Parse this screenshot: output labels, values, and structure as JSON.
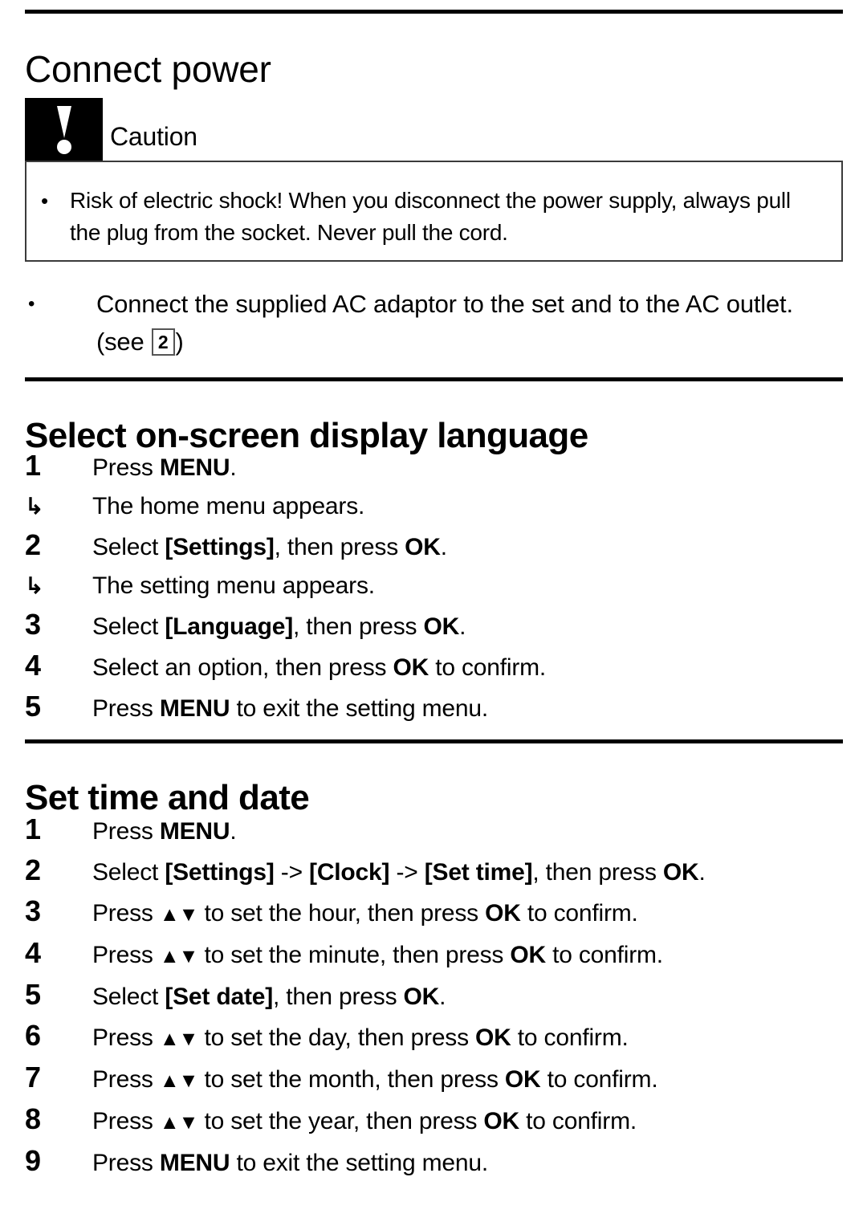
{
  "document": {
    "sections": [
      {
        "id": "connect-power",
        "title": "Connect power",
        "caution": {
          "label": "Caution",
          "bullet_marker": "•",
          "text": "Risk of electric shock! When you disconnect the power supply, always pull the plug from the socket. Never pull the cord."
        },
        "bullet": {
          "marker": "•",
          "text_before": "Connect the supplied AC adaptor to the set and to the AC outlet.  (see ",
          "figure_ref": "2",
          "text_after": ")"
        }
      },
      {
        "id": "select-language",
        "title": "Select on-screen display language",
        "steps": [
          {
            "number": "1",
            "parts": [
              {
                "text": "Press ",
                "bold": false
              },
              {
                "text": "MENU",
                "bold": true
              },
              {
                "text": ".",
                "bold": false
              }
            ],
            "result": {
              "arrow": "↳",
              "text": "The home menu appears."
            }
          },
          {
            "number": "2",
            "parts": [
              {
                "text": "Select ",
                "bold": false
              },
              {
                "text": "[Settings]",
                "bold": true
              },
              {
                "text": ", then press ",
                "bold": false
              },
              {
                "text": "OK",
                "bold": true
              },
              {
                "text": ".",
                "bold": false
              }
            ],
            "result": {
              "arrow": "↳",
              "text": "The setting menu appears."
            }
          },
          {
            "number": "3",
            "parts": [
              {
                "text": "Select ",
                "bold": false
              },
              {
                "text": "[Language]",
                "bold": true
              },
              {
                "text": ", then press ",
                "bold": false
              },
              {
                "text": "OK",
                "bold": true
              },
              {
                "text": ".",
                "bold": false
              }
            ]
          },
          {
            "number": "4",
            "parts": [
              {
                "text": "Select an option, then press ",
                "bold": false
              },
              {
                "text": "OK",
                "bold": true
              },
              {
                "text": " to confirm.",
                "bold": false
              }
            ]
          },
          {
            "number": "5",
            "parts": [
              {
                "text": "Press ",
                "bold": false
              },
              {
                "text": "MENU",
                "bold": true
              },
              {
                "text": " to exit the setting menu.",
                "bold": false
              }
            ]
          }
        ]
      },
      {
        "id": "set-time-date",
        "title": "Set time and date",
        "steps": [
          {
            "number": "1",
            "parts": [
              {
                "text": "Press ",
                "bold": false
              },
              {
                "text": "MENU",
                "bold": true
              },
              {
                "text": ".",
                "bold": false
              }
            ]
          },
          {
            "number": "2",
            "parts": [
              {
                "text": "Select ",
                "bold": false
              },
              {
                "text": "[Settings]",
                "bold": true
              },
              {
                "text": " -> ",
                "bold": false
              },
              {
                "text": "[Clock]",
                "bold": true
              },
              {
                "text": " -> ",
                "bold": false
              },
              {
                "text": "[Set time]",
                "bold": true
              },
              {
                "text": ", then press ",
                "bold": false
              },
              {
                "text": "OK",
                "bold": true
              },
              {
                "text": ".",
                "bold": false
              }
            ]
          },
          {
            "number": "3",
            "parts": [
              {
                "text": "Press ",
                "bold": false
              },
              {
                "text": "▲▼",
                "bold": false,
                "arrows": true
              },
              {
                "text": " to set the hour, then press ",
                "bold": false
              },
              {
                "text": "OK",
                "bold": true
              },
              {
                "text": " to confirm.",
                "bold": false
              }
            ]
          },
          {
            "number": "4",
            "parts": [
              {
                "text": "Press ",
                "bold": false
              },
              {
                "text": "▲▼",
                "bold": false,
                "arrows": true
              },
              {
                "text": " to set the minute, then press ",
                "bold": false
              },
              {
                "text": "OK",
                "bold": true
              },
              {
                "text": " to confirm.",
                "bold": false
              }
            ]
          },
          {
            "number": "5",
            "parts": [
              {
                "text": "Select ",
                "bold": false
              },
              {
                "text": "[Set date]",
                "bold": true
              },
              {
                "text": ", then press ",
                "bold": false
              },
              {
                "text": "OK",
                "bold": true
              },
              {
                "text": ".",
                "bold": false
              }
            ]
          },
          {
            "number": "6",
            "parts": [
              {
                "text": "Press ",
                "bold": false
              },
              {
                "text": "▲▼",
                "bold": false,
                "arrows": true
              },
              {
                "text": " to set the day, then press ",
                "bold": false
              },
              {
                "text": "OK",
                "bold": true
              },
              {
                "text": " to confirm.",
                "bold": false
              }
            ]
          },
          {
            "number": "7",
            "parts": [
              {
                "text": "Press ",
                "bold": false
              },
              {
                "text": "▲▼",
                "bold": false,
                "arrows": true
              },
              {
                "text": " to set the month, then press ",
                "bold": false
              },
              {
                "text": "OK",
                "bold": true
              },
              {
                "text": " to confirm.",
                "bold": false
              }
            ]
          },
          {
            "number": "8",
            "parts": [
              {
                "text": "Press ",
                "bold": false
              },
              {
                "text": "▲▼",
                "bold": false,
                "arrows": true
              },
              {
                "text": " to set the year, then press ",
                "bold": false
              },
              {
                "text": "OK",
                "bold": true
              },
              {
                "text": " to confirm.",
                "bold": false
              }
            ]
          },
          {
            "number": "9",
            "parts": [
              {
                "text": "Press ",
                "bold": false
              },
              {
                "text": "MENU",
                "bold": true
              },
              {
                "text": " to exit the setting menu.",
                "bold": false
              }
            ]
          }
        ]
      }
    ]
  }
}
